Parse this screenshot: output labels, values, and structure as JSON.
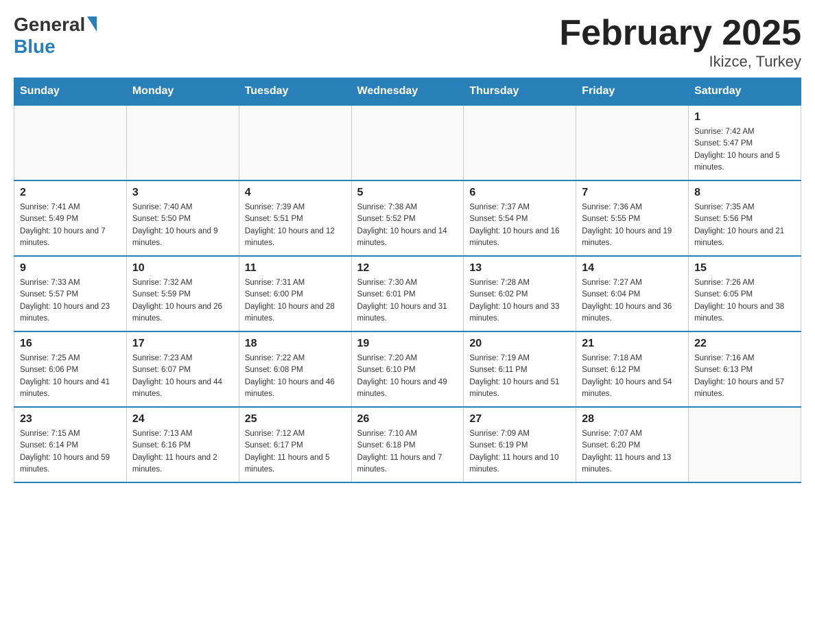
{
  "header": {
    "logo_general": "General",
    "logo_blue": "Blue",
    "month_title": "February 2025",
    "location": "Ikizce, Turkey"
  },
  "weekdays": [
    "Sunday",
    "Monday",
    "Tuesday",
    "Wednesday",
    "Thursday",
    "Friday",
    "Saturday"
  ],
  "weeks": [
    [
      {
        "day": "",
        "info": ""
      },
      {
        "day": "",
        "info": ""
      },
      {
        "day": "",
        "info": ""
      },
      {
        "day": "",
        "info": ""
      },
      {
        "day": "",
        "info": ""
      },
      {
        "day": "",
        "info": ""
      },
      {
        "day": "1",
        "info": "Sunrise: 7:42 AM\nSunset: 5:47 PM\nDaylight: 10 hours and 5 minutes."
      }
    ],
    [
      {
        "day": "2",
        "info": "Sunrise: 7:41 AM\nSunset: 5:49 PM\nDaylight: 10 hours and 7 minutes."
      },
      {
        "day": "3",
        "info": "Sunrise: 7:40 AM\nSunset: 5:50 PM\nDaylight: 10 hours and 9 minutes."
      },
      {
        "day": "4",
        "info": "Sunrise: 7:39 AM\nSunset: 5:51 PM\nDaylight: 10 hours and 12 minutes."
      },
      {
        "day": "5",
        "info": "Sunrise: 7:38 AM\nSunset: 5:52 PM\nDaylight: 10 hours and 14 minutes."
      },
      {
        "day": "6",
        "info": "Sunrise: 7:37 AM\nSunset: 5:54 PM\nDaylight: 10 hours and 16 minutes."
      },
      {
        "day": "7",
        "info": "Sunrise: 7:36 AM\nSunset: 5:55 PM\nDaylight: 10 hours and 19 minutes."
      },
      {
        "day": "8",
        "info": "Sunrise: 7:35 AM\nSunset: 5:56 PM\nDaylight: 10 hours and 21 minutes."
      }
    ],
    [
      {
        "day": "9",
        "info": "Sunrise: 7:33 AM\nSunset: 5:57 PM\nDaylight: 10 hours and 23 minutes."
      },
      {
        "day": "10",
        "info": "Sunrise: 7:32 AM\nSunset: 5:59 PM\nDaylight: 10 hours and 26 minutes."
      },
      {
        "day": "11",
        "info": "Sunrise: 7:31 AM\nSunset: 6:00 PM\nDaylight: 10 hours and 28 minutes."
      },
      {
        "day": "12",
        "info": "Sunrise: 7:30 AM\nSunset: 6:01 PM\nDaylight: 10 hours and 31 minutes."
      },
      {
        "day": "13",
        "info": "Sunrise: 7:28 AM\nSunset: 6:02 PM\nDaylight: 10 hours and 33 minutes."
      },
      {
        "day": "14",
        "info": "Sunrise: 7:27 AM\nSunset: 6:04 PM\nDaylight: 10 hours and 36 minutes."
      },
      {
        "day": "15",
        "info": "Sunrise: 7:26 AM\nSunset: 6:05 PM\nDaylight: 10 hours and 38 minutes."
      }
    ],
    [
      {
        "day": "16",
        "info": "Sunrise: 7:25 AM\nSunset: 6:06 PM\nDaylight: 10 hours and 41 minutes."
      },
      {
        "day": "17",
        "info": "Sunrise: 7:23 AM\nSunset: 6:07 PM\nDaylight: 10 hours and 44 minutes."
      },
      {
        "day": "18",
        "info": "Sunrise: 7:22 AM\nSunset: 6:08 PM\nDaylight: 10 hours and 46 minutes."
      },
      {
        "day": "19",
        "info": "Sunrise: 7:20 AM\nSunset: 6:10 PM\nDaylight: 10 hours and 49 minutes."
      },
      {
        "day": "20",
        "info": "Sunrise: 7:19 AM\nSunset: 6:11 PM\nDaylight: 10 hours and 51 minutes."
      },
      {
        "day": "21",
        "info": "Sunrise: 7:18 AM\nSunset: 6:12 PM\nDaylight: 10 hours and 54 minutes."
      },
      {
        "day": "22",
        "info": "Sunrise: 7:16 AM\nSunset: 6:13 PM\nDaylight: 10 hours and 57 minutes."
      }
    ],
    [
      {
        "day": "23",
        "info": "Sunrise: 7:15 AM\nSunset: 6:14 PM\nDaylight: 10 hours and 59 minutes."
      },
      {
        "day": "24",
        "info": "Sunrise: 7:13 AM\nSunset: 6:16 PM\nDaylight: 11 hours and 2 minutes."
      },
      {
        "day": "25",
        "info": "Sunrise: 7:12 AM\nSunset: 6:17 PM\nDaylight: 11 hours and 5 minutes."
      },
      {
        "day": "26",
        "info": "Sunrise: 7:10 AM\nSunset: 6:18 PM\nDaylight: 11 hours and 7 minutes."
      },
      {
        "day": "27",
        "info": "Sunrise: 7:09 AM\nSunset: 6:19 PM\nDaylight: 11 hours and 10 minutes."
      },
      {
        "day": "28",
        "info": "Sunrise: 7:07 AM\nSunset: 6:20 PM\nDaylight: 11 hours and 13 minutes."
      },
      {
        "day": "",
        "info": ""
      }
    ]
  ]
}
